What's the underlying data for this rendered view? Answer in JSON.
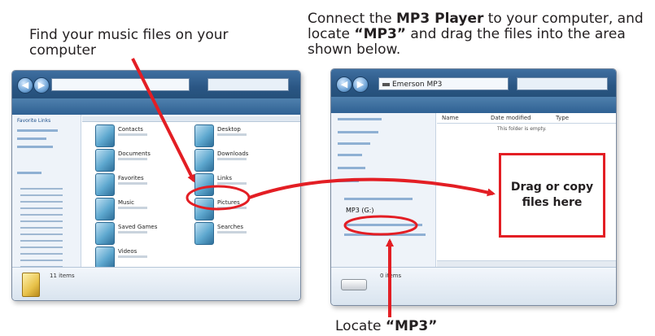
{
  "captions": {
    "find_text": "Find your music files on your computer",
    "connect_pre": "Connect the ",
    "connect_bold1": "MP3 Player",
    "connect_mid1": " to your computer, and locate ",
    "connect_bold2": "“MP3”",
    "connect_post": " and drag the files into the area shown below.",
    "locate_pre": "Locate ",
    "locate_bold": "“MP3”"
  },
  "left_window": {
    "nav_left": "Favorite Links",
    "items": [
      {
        "name": "Contacts"
      },
      {
        "name": "Documents"
      },
      {
        "name": "Favorites"
      },
      {
        "name": "Music"
      },
      {
        "name": "Saved Games"
      },
      {
        "name": "Videos"
      },
      {
        "name": "Desktop"
      },
      {
        "name": "Downloads"
      },
      {
        "name": "Links"
      },
      {
        "name": "Pictures"
      },
      {
        "name": "Searches"
      }
    ],
    "status": "11 items"
  },
  "right_window": {
    "address": "Emerson MP3",
    "col_name": "Name",
    "col_date": "Date modified",
    "col_type": "Type",
    "empty_msg": "This folder is empty.",
    "drive_label": "MP3  (G:)",
    "status": "0 items"
  },
  "dropzone": {
    "line1": "Drag or copy",
    "line2": "files here"
  },
  "colors": {
    "annotation_red": "#e31e24",
    "title_blue": "#2a5684"
  }
}
